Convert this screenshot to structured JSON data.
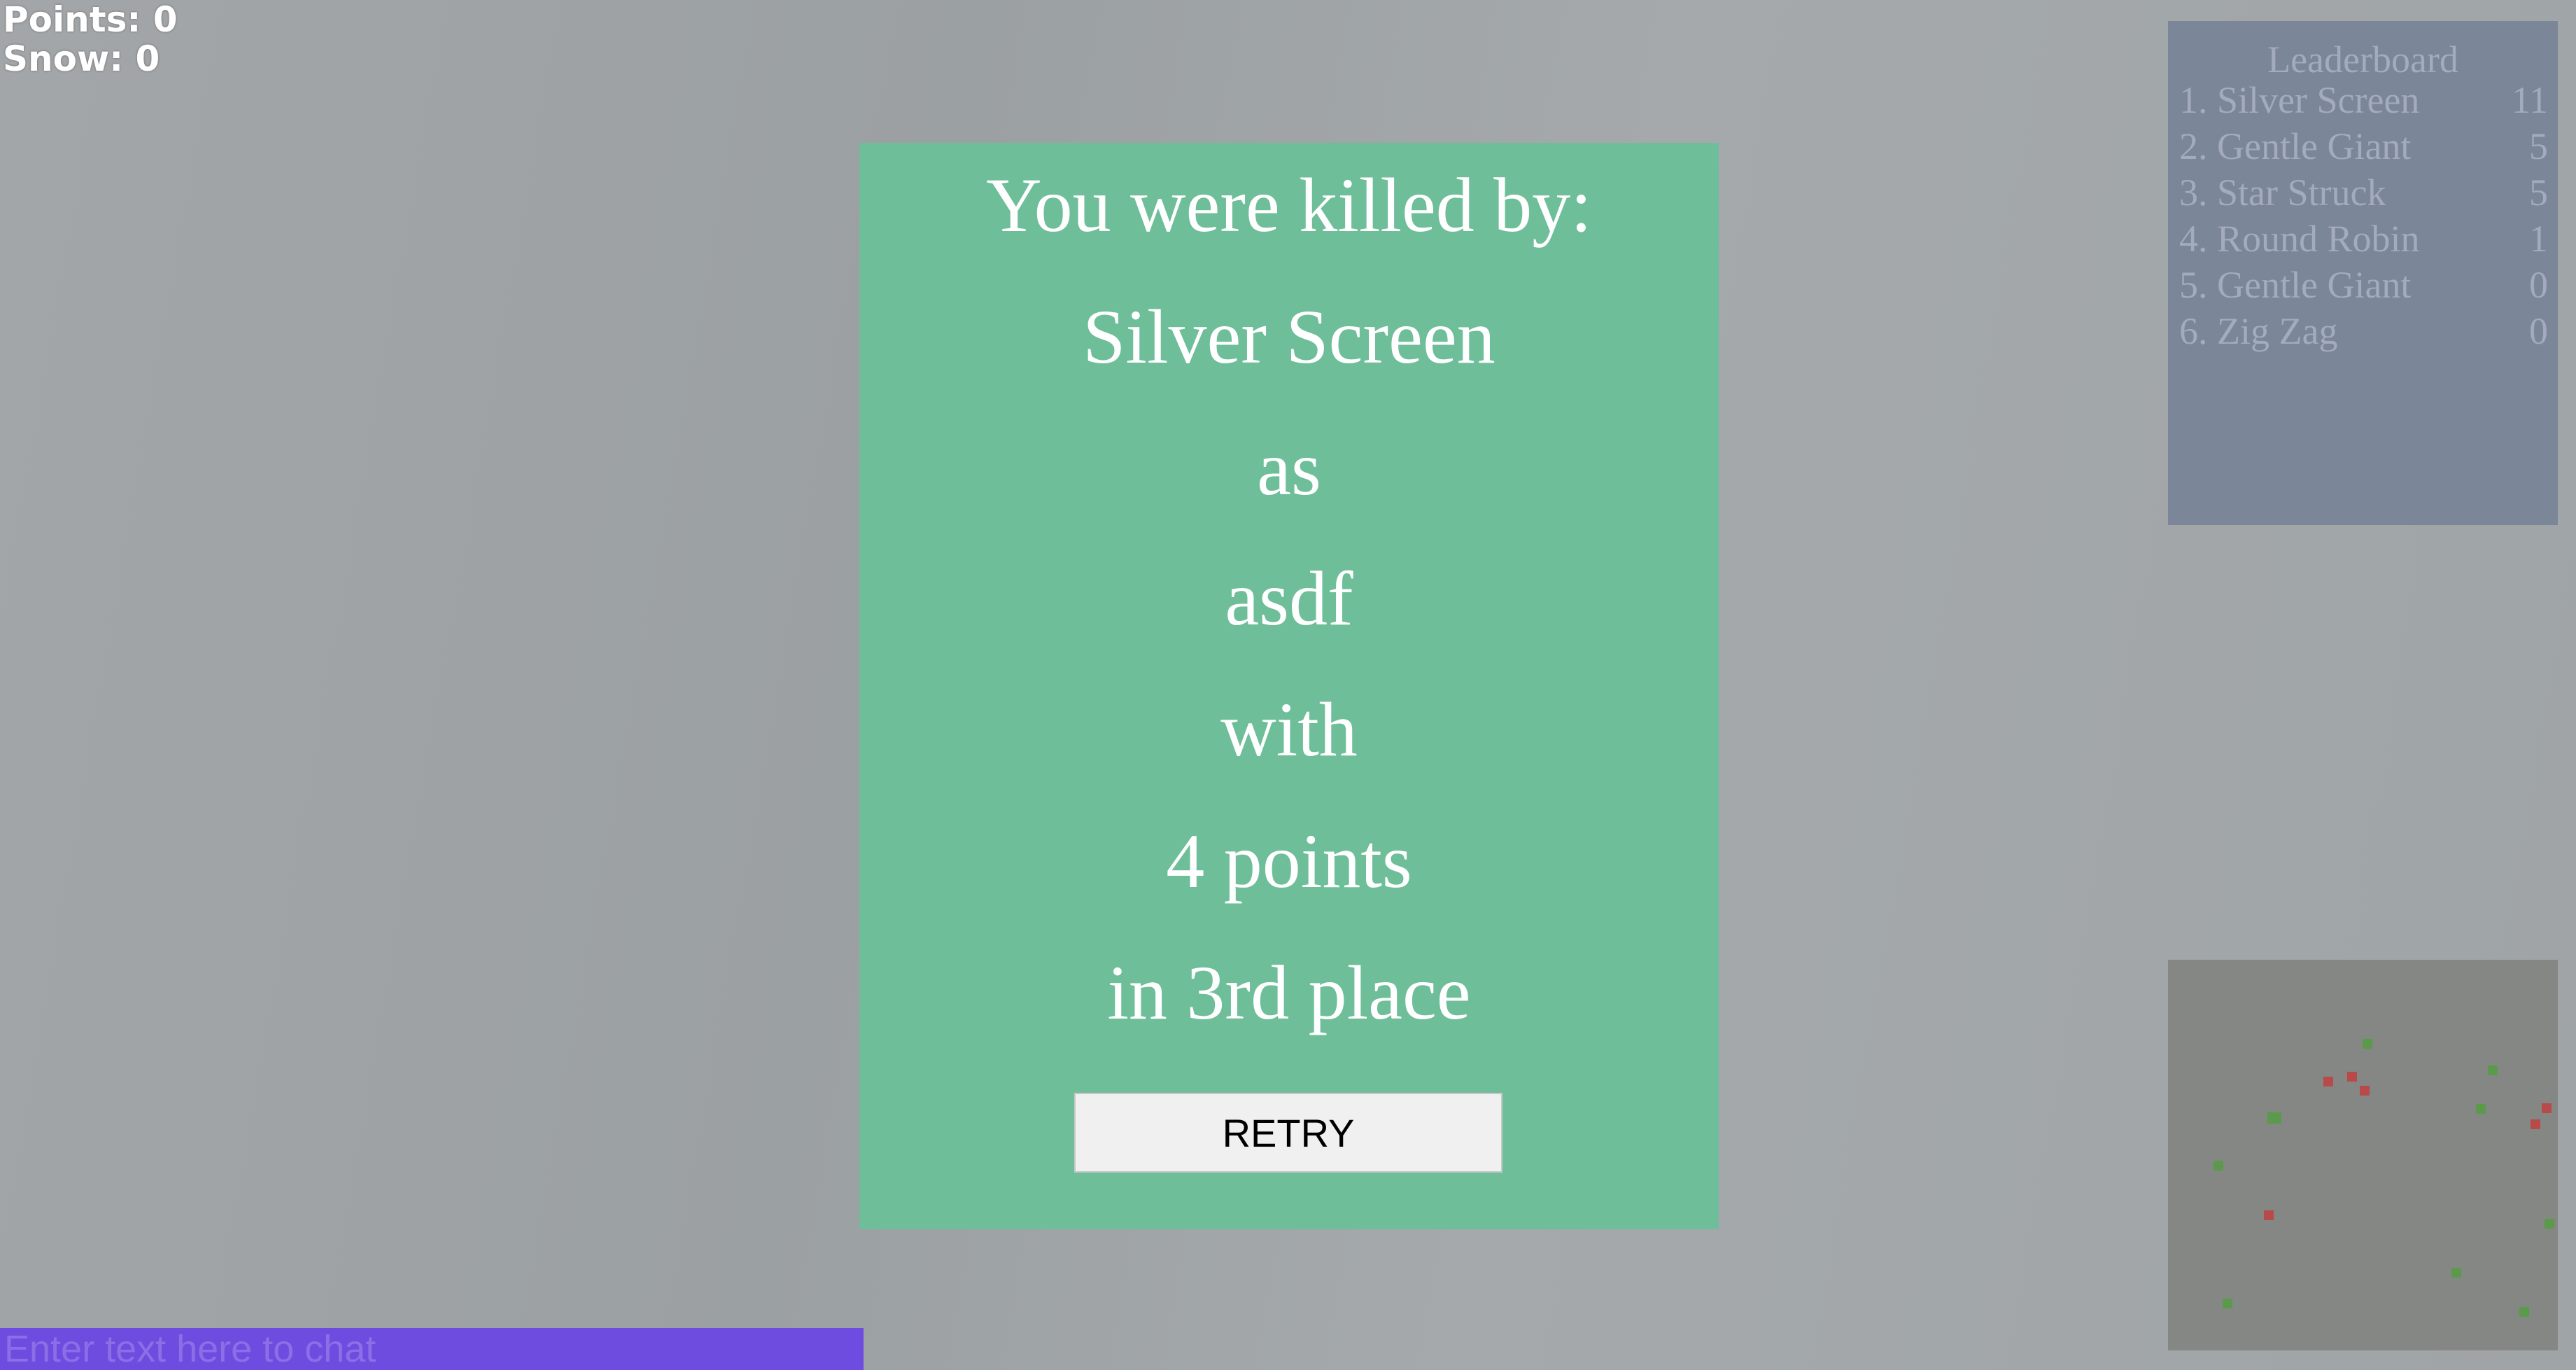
{
  "hud": {
    "points_text": "Points: 0",
    "snow_text": "Snow: 0"
  },
  "death_panel": {
    "lines": [
      "You were killed by:",
      "Silver Screen",
      "as",
      "asdf",
      "with",
      "4 points",
      "in 3rd place"
    ],
    "retry_label": "RETRY"
  },
  "leaderboard": {
    "title": "Leaderboard",
    "entries": [
      {
        "rank_name": "1. Silver Screen",
        "score": "11"
      },
      {
        "rank_name": "2. Gentle Giant",
        "score": "5"
      },
      {
        "rank_name": "3. Star Struck",
        "score": "5"
      },
      {
        "rank_name": "4. Round Robin",
        "score": "1"
      },
      {
        "rank_name": "5. Gentle Giant",
        "score": "0"
      },
      {
        "rank_name": "6. Zig Zag",
        "score": "0"
      }
    ]
  },
  "chat": {
    "placeholder": "Enter text here to chat",
    "value": ""
  },
  "colors": {
    "panel_green": "#6ebe9a",
    "leaderboard_bg": "#7b8699",
    "minimap_bg": "#858785",
    "chat_bg": "#6f4ce0",
    "enemy_red": "#b84a4a",
    "food_green": "#5a9a4a"
  }
}
